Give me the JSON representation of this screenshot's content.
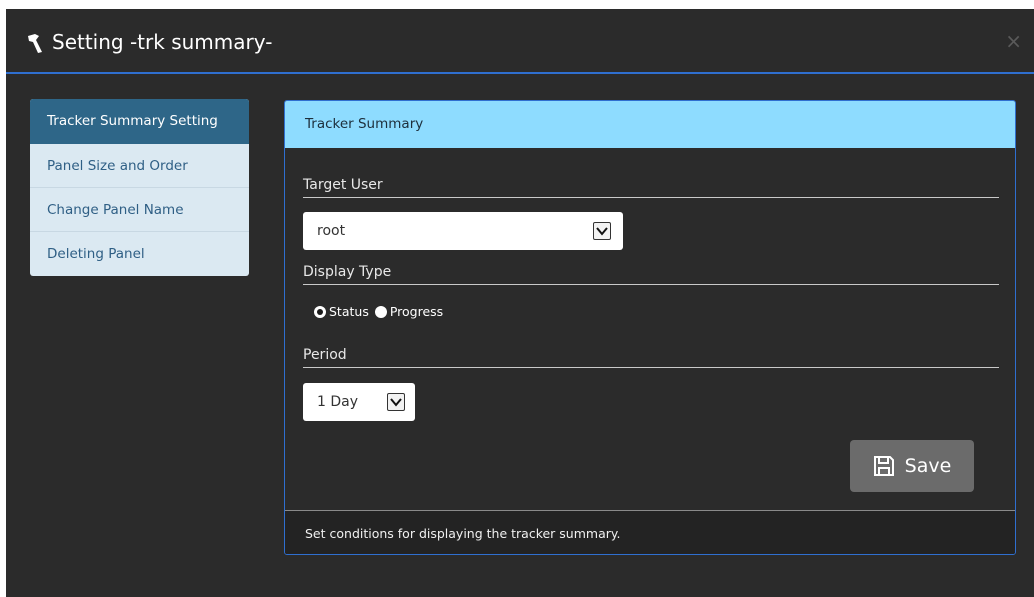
{
  "dialog": {
    "title": "Setting -trk summary-",
    "title_icon": "wrench-icon",
    "close_label": "×"
  },
  "sidebar": {
    "items": [
      {
        "label": "Tracker Summary Setting",
        "active": true
      },
      {
        "label": "Panel Size and Order",
        "active": false
      },
      {
        "label": "Change Panel Name",
        "active": false
      },
      {
        "label": "Deleting Panel",
        "active": false
      }
    ]
  },
  "panel": {
    "header": "Tracker Summary",
    "target_user": {
      "label": "Target User",
      "value": "root"
    },
    "display_type": {
      "label": "Display Type",
      "options": [
        {
          "label": "Status",
          "checked": true
        },
        {
          "label": "Progress",
          "checked": false
        }
      ]
    },
    "period": {
      "label": "Period",
      "value": "1 Day"
    },
    "save_label": "Save",
    "footer": "Set conditions for displaying the tracker summary."
  },
  "colors": {
    "background": "#2b2b2b",
    "accent": "#2f6fd0",
    "panel_header": "#8edcff",
    "sidebar_active": "#2e6688",
    "sidebar_bg": "#dbe9f2"
  }
}
